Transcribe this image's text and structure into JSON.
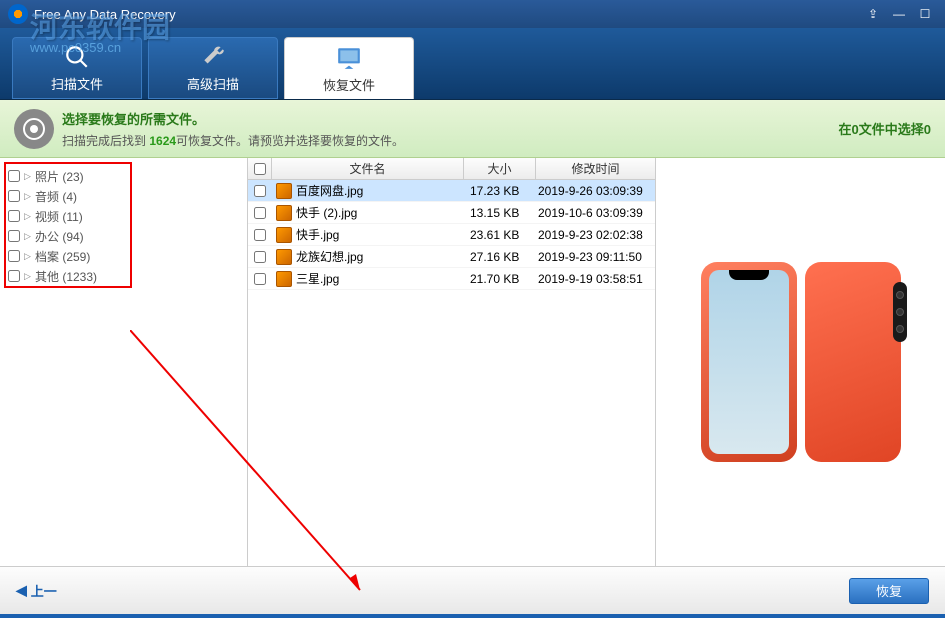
{
  "titlebar": {
    "title": "Free Any Data Recovery"
  },
  "watermark": {
    "text": "河东软件园",
    "url": "www.pc0359.cn"
  },
  "tabs": [
    {
      "label": "扫描文件"
    },
    {
      "label": "高级扫描"
    },
    {
      "label": "恢复文件"
    }
  ],
  "info": {
    "title": "选择要恢复的所需文件。",
    "prefix": "扫描完成后找到 ",
    "count": "1624",
    "suffix": "可恢复文件。请预览并选择要恢复的文件。",
    "right": "在0文件中选择0"
  },
  "categories": [
    {
      "label": "照片",
      "count": 23
    },
    {
      "label": "音频",
      "count": 4
    },
    {
      "label": "视频",
      "count": 11
    },
    {
      "label": "办公",
      "count": 94
    },
    {
      "label": "档案",
      "count": 259
    },
    {
      "label": "其他",
      "count": 1233
    }
  ],
  "columns": {
    "name": "文件名",
    "size": "大小",
    "date": "修改时间"
  },
  "files": [
    {
      "name": "百度网盘.jpg",
      "size": "17.23 KB",
      "date": "2019-9-26 03:09:39",
      "selected": true
    },
    {
      "name": "快手 (2).jpg",
      "size": "13.15 KB",
      "date": "2019-10-6 03:09:39",
      "selected": false
    },
    {
      "name": "快手.jpg",
      "size": "23.61 KB",
      "date": "2019-9-23 02:02:38",
      "selected": false
    },
    {
      "name": "龙族幻想.jpg",
      "size": "27.16 KB",
      "date": "2019-9-23 09:11:50",
      "selected": false
    },
    {
      "name": "三星.jpg",
      "size": "21.70 KB",
      "date": "2019-9-19 03:58:51",
      "selected": false
    }
  ],
  "footer": {
    "back": "上一",
    "recover": "恢复"
  }
}
